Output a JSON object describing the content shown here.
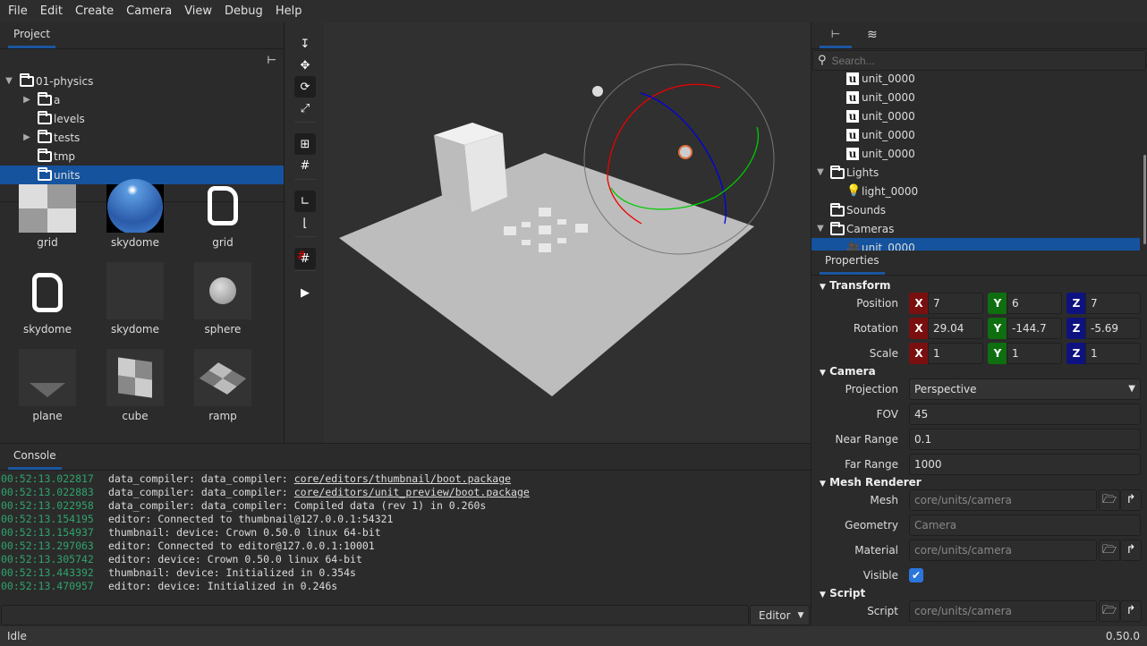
{
  "menu": [
    "File",
    "Edit",
    "Create",
    "Camera",
    "View",
    "Debug",
    "Help"
  ],
  "project": {
    "tab": "Project",
    "tree": [
      {
        "label": "01-physics",
        "expanded": true
      },
      {
        "label": "a",
        "expandable": true
      },
      {
        "label": "levels"
      },
      {
        "label": "tests",
        "expandable": true
      },
      {
        "label": "tmp"
      },
      {
        "label": "units",
        "selected": true
      }
    ],
    "assets": [
      {
        "label": "grid",
        "icon": "grid-texture"
      },
      {
        "label": "skydome",
        "icon": "skydome-texture"
      },
      {
        "label": "grid",
        "icon": "file-icon"
      },
      {
        "label": "skydome",
        "icon": "file-icon"
      },
      {
        "label": "skydome",
        "icon": "empty"
      },
      {
        "label": "sphere",
        "icon": "sphere-mesh"
      },
      {
        "label": "plane",
        "icon": "plane-mesh"
      },
      {
        "label": "cube",
        "icon": "cube-mesh"
      },
      {
        "label": "ramp",
        "icon": "ramp-mesh"
      }
    ]
  },
  "toolbar": [
    "place",
    "move",
    "rotate",
    "scale",
    "snap-to-grid",
    "grid",
    "local-axes",
    "world-axes",
    "snap-magnet-grid",
    "play"
  ],
  "console": {
    "tab": "Console",
    "lines": [
      {
        "ts": "00:52:13.022817",
        "pre": "data_compiler: data_compiler: ",
        "link": "core/editors/thumbnail/boot.package"
      },
      {
        "ts": "00:52:13.022883",
        "pre": "data_compiler: data_compiler: ",
        "link": "core/editors/unit_preview/boot.package"
      },
      {
        "ts": "00:52:13.022958",
        "pre": "data_compiler: data_compiler: Compiled data (rev 1) in 0.260s"
      },
      {
        "ts": "00:52:13.154195",
        "pre": "editor: Connected to thumbnail@127.0.0.1:54321"
      },
      {
        "ts": "00:52:13.154937",
        "pre": "thumbnail: device: Crown 0.50.0 linux 64-bit"
      },
      {
        "ts": "00:52:13.297063",
        "pre": "editor: Connected to editor@127.0.0.1:10001"
      },
      {
        "ts": "00:52:13.305742",
        "pre": "editor: device: Crown 0.50.0 linux 64-bit"
      },
      {
        "ts": "00:52:13.443392",
        "pre": "thumbnail: device: Initialized in 0.354s"
      },
      {
        "ts": "00:52:13.470957",
        "pre": "editor: device: Initialized in 0.246s"
      }
    ],
    "input": "",
    "target": "Editor"
  },
  "status": {
    "left": "Idle",
    "right": "0.50.0"
  },
  "level": {
    "search_placeholder": "Search...",
    "tree": [
      {
        "label": "unit_0000",
        "icon": "unit",
        "indent": 2
      },
      {
        "label": "unit_0000",
        "icon": "unit",
        "indent": 2
      },
      {
        "label": "unit_0000",
        "icon": "unit",
        "indent": 2
      },
      {
        "label": "unit_0000",
        "icon": "unit",
        "indent": 2
      },
      {
        "label": "unit_0000",
        "icon": "unit",
        "indent": 2
      },
      {
        "label": "Lights",
        "icon": "folder",
        "indent": 0,
        "expanded": true
      },
      {
        "label": "light_0000",
        "icon": "light",
        "indent": 2
      },
      {
        "label": "Sounds",
        "icon": "folder",
        "indent": 1
      },
      {
        "label": "Cameras",
        "icon": "folder",
        "indent": 0,
        "expanded": true
      },
      {
        "label": "unit_0000",
        "icon": "camera",
        "indent": 2,
        "selected": true
      }
    ]
  },
  "properties": {
    "tab": "Properties",
    "transform": {
      "title": "Transform",
      "position_label": "Position",
      "rotation_label": "Rotation",
      "scale_label": "Scale",
      "position": [
        "7",
        "6",
        "7"
      ],
      "rotation": [
        "29.04",
        "-144.7",
        "-5.69"
      ],
      "scale": [
        "1",
        "1",
        "1"
      ],
      "axes": [
        "X",
        "Y",
        "Z"
      ]
    },
    "camera": {
      "title": "Camera",
      "projection_label": "Projection",
      "projection": "Perspective",
      "fov_label": "FOV",
      "fov": "45",
      "near_label": "Near Range",
      "near": "0.1",
      "far_label": "Far Range",
      "far": "1000"
    },
    "mesh": {
      "title": "Mesh Renderer",
      "mesh_label": "Mesh",
      "mesh": "core/units/camera",
      "geometry_label": "Geometry",
      "geometry": "Camera",
      "material_label": "Material",
      "material": "core/units/camera",
      "visible_label": "Visible",
      "visible": true
    },
    "script": {
      "title": "Script",
      "script_label": "Script",
      "script": "core/units/camera"
    }
  },
  "colors": {
    "accent": "#15539e",
    "x": "#7a0f0f",
    "y": "#0f6e0f",
    "z": "#0d1280",
    "timestamp": "#2fa36b"
  }
}
